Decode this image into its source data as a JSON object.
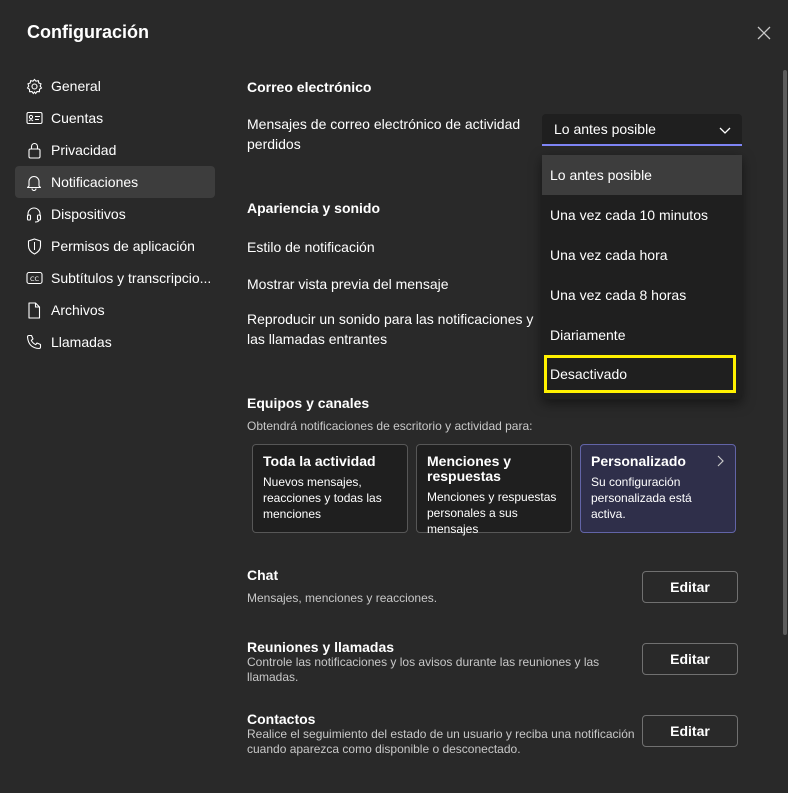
{
  "dialog": {
    "title": "Configuración"
  },
  "sidebar": {
    "items": [
      {
        "label": "General",
        "icon": "gear-icon"
      },
      {
        "label": "Cuentas",
        "icon": "id-card-icon"
      },
      {
        "label": "Privacidad",
        "icon": "lock-icon"
      },
      {
        "label": "Notificaciones",
        "icon": "bell-icon"
      },
      {
        "label": "Dispositivos",
        "icon": "headset-icon"
      },
      {
        "label": "Permisos de aplicación",
        "icon": "shield-icon"
      },
      {
        "label": "Subtítulos y transcripcio...",
        "icon": "cc-icon"
      },
      {
        "label": "Archivos",
        "icon": "file-icon"
      },
      {
        "label": "Llamadas",
        "icon": "phone-icon"
      }
    ],
    "active_index": 3
  },
  "email": {
    "title": "Correo electrónico",
    "missed_label_line1": "Mensajes de correo electrónico de actividad",
    "missed_label_line2": "perdidos",
    "selected_value": "Lo antes posible",
    "options": [
      "Lo antes posible",
      "Una vez cada 10 minutos",
      "Una vez cada hora",
      "Una vez cada 8 horas",
      "Diariamente",
      "Desactivado"
    ]
  },
  "appearance": {
    "title": "Apariencia y sonido",
    "style_label": "Estilo de notificación",
    "preview_label": "Mostrar vista previa del mensaje",
    "sound_label_line1": "Reproducir un sonido para las notificaciones y",
    "sound_label_line2": "las llamadas entrantes"
  },
  "teams": {
    "title": "Equipos y canales",
    "subtitle": "Obtendrá notificaciones de escritorio y actividad para:",
    "cards": [
      {
        "title": "Toda la actividad",
        "desc": "Nuevos mensajes, reacciones y todas las menciones"
      },
      {
        "title": "Menciones y respuestas",
        "desc": "Menciones y respuestas personales a sus mensajes"
      },
      {
        "title": "Personalizado",
        "desc": "Su configuración personalizada está activa."
      }
    ]
  },
  "chat": {
    "title": "Chat",
    "desc": "Mensajes, menciones y reacciones.",
    "button": "Editar"
  },
  "meetings": {
    "title": "Reuniones y llamadas",
    "desc": "Controle las notificaciones y los avisos durante las reuniones y las llamadas.",
    "button": "Editar"
  },
  "contacts": {
    "title": "Contactos",
    "desc": "Realice el seguimiento del estado de un usuario y reciba una notificación cuando aparezca como disponible o desconectado.",
    "button": "Editar"
  },
  "colors": {
    "background": "#292929",
    "accent": "#7f85f5",
    "highlight": "#fff100"
  }
}
